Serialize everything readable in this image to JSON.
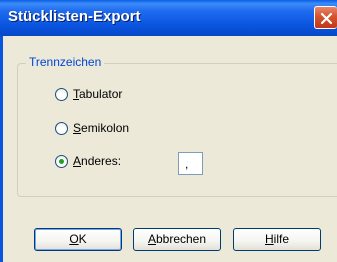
{
  "window": {
    "title": "Stücklisten-Export"
  },
  "group": {
    "label": "Trennzeichen"
  },
  "options": [
    {
      "label_first": "T",
      "label_rest": "abulator",
      "selected": false
    },
    {
      "label_first": "S",
      "label_rest": "emikolon",
      "selected": false
    },
    {
      "label_first": "A",
      "label_rest": "nderes:",
      "selected": true
    }
  ],
  "custom_separator": {
    "value": ","
  },
  "buttons": {
    "ok_first": "O",
    "ok_rest": "K",
    "cancel_first": "A",
    "cancel_rest": "bbrechen",
    "help_first": "H",
    "help_rest": "ilfe"
  },
  "colors": {
    "titlebar": "#0a55e0",
    "close_button": "#d4542f",
    "dialog_background": "#ece9d8",
    "group_label": "#0046d5",
    "radio_dot": "#21a121"
  },
  "icons": {
    "close": "close-icon"
  }
}
